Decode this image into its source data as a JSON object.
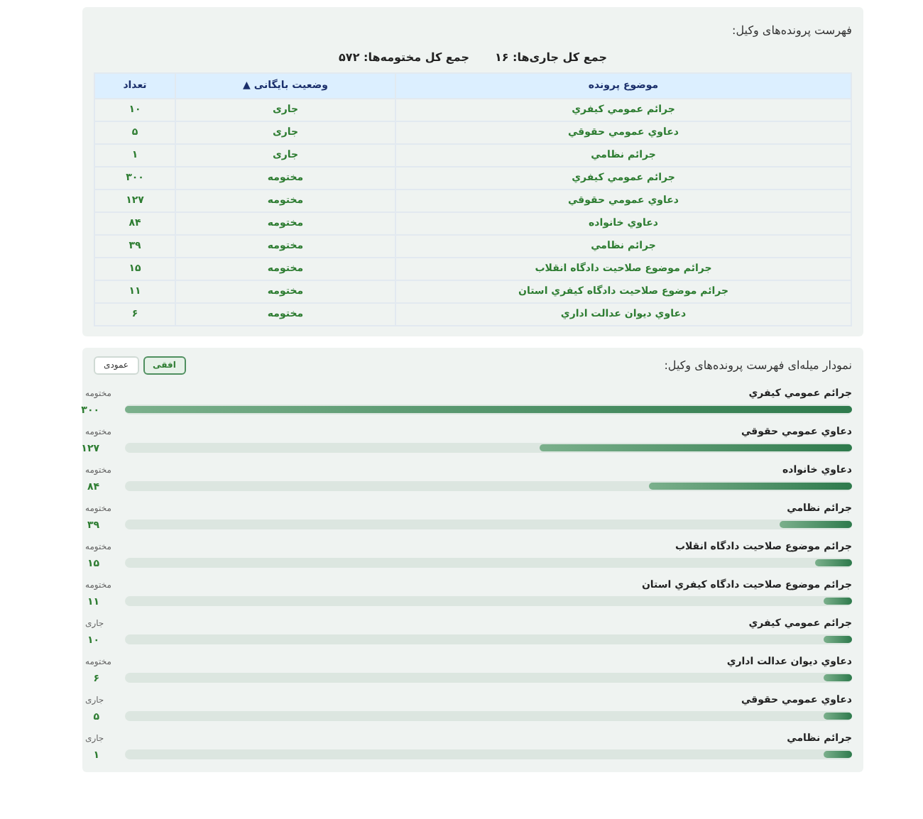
{
  "list_panel": {
    "title": "فهرست پرونده‌های وکیل:",
    "totals": [
      {
        "label": "جمع کل جاری‌ها:",
        "value": "۱۶"
      },
      {
        "label": "جمع کل مختومه‌ها:",
        "value": "۵۷۲"
      }
    ],
    "table": {
      "columns": [
        {
          "label": "موضوع پرونده"
        },
        {
          "label": "وضعیت بایگانی",
          "sort_indicator": "▲"
        },
        {
          "label": "تعداد"
        }
      ],
      "rows": [
        [
          "جرائم عمومي كيفري",
          "جاری",
          "۱۰"
        ],
        [
          "دعاوي عمومي حقوقي",
          "جاری",
          "۵"
        ],
        [
          "جرائم نظامي",
          "جاری",
          "۱"
        ],
        [
          "جرائم عمومي كيفري",
          "مختومه",
          "۳۰۰"
        ],
        [
          "دعاوي عمومي حقوقي",
          "مختومه",
          "۱۲۷"
        ],
        [
          "دعاوي خانواده",
          "مختومه",
          "۸۴"
        ],
        [
          "جرائم نظامي",
          "مختومه",
          "۳۹"
        ],
        [
          "جرائم موضوع صلاحيت دادگاه انقلاب",
          "مختومه",
          "۱۵"
        ],
        [
          "جرائم موضوع صلاحيت دادگاه كيفري استان",
          "مختومه",
          "۱۱"
        ],
        [
          "دعاوي ديوان عدالت اداري",
          "مختومه",
          "۶"
        ]
      ]
    }
  },
  "chart_panel": {
    "title": "نمودار میله‌ای فهرست پرونده‌های وکیل:",
    "buttons": [
      {
        "label": "افقی",
        "selected": true
      },
      {
        "label": "عمودی",
        "selected": false
      }
    ],
    "bars": [
      {
        "label": "جرائم عمومي كيفري",
        "status": "مختومه",
        "value": "۳۰۰",
        "level": 1
      },
      {
        "label": "دعاوي عمومي حقوقي",
        "status": "مختومه",
        "value": "۱۲۷",
        "level": 0.43
      },
      {
        "label": "دعاوي خانواده",
        "status": "مختومه",
        "value": "۸۴",
        "level": 0.28
      },
      {
        "label": "جرائم نظامي",
        "status": "مختومه",
        "value": "۳۹",
        "level": 0.1
      },
      {
        "label": "جرائم موضوع صلاحيت دادگاه انقلاب",
        "status": "مختومه",
        "value": "۱۵",
        "level": 0.05
      },
      {
        "label": "جرائم موضوع صلاحيت دادگاه كيفري استان",
        "status": "مختومه",
        "value": "۱۱",
        "level": 0.04
      },
      {
        "label": "جرائم عمومي كيفري",
        "status": "جاری",
        "value": "۱۰",
        "level": 0.04
      },
      {
        "label": "دعاوي ديوان عدالت اداري",
        "status": "مختومه",
        "value": "۶",
        "level": 0.04
      },
      {
        "label": "دعاوي عمومي حقوقي",
        "status": "جاری",
        "value": "۵",
        "level": 0.04
      },
      {
        "label": "جرائم نظامي",
        "status": "جاری",
        "value": "۱",
        "level": 0.04
      }
    ]
  }
}
